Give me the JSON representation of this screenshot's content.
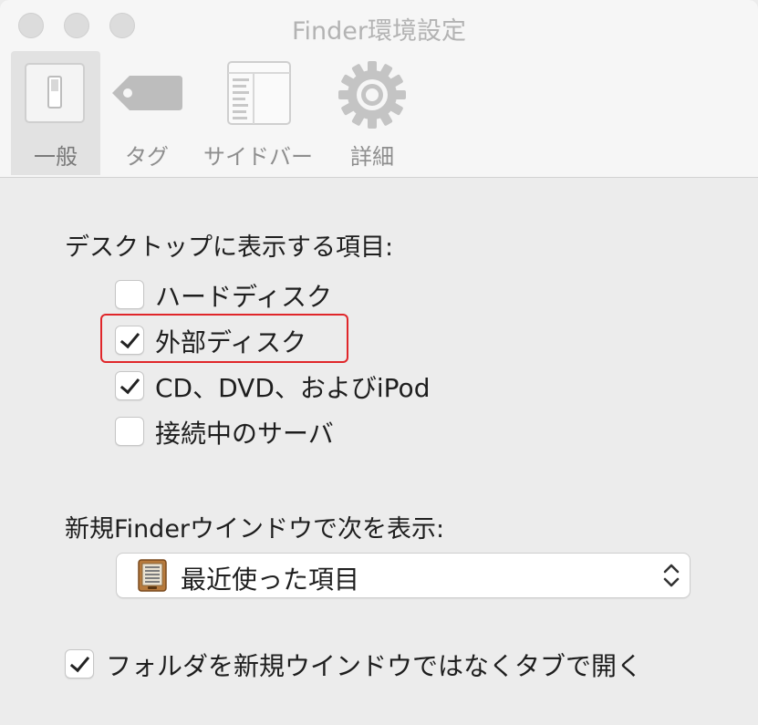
{
  "window": {
    "title": "Finder環境設定"
  },
  "toolbar": {
    "tabs": [
      {
        "label": "一般",
        "icon": "switch-icon",
        "selected": true
      },
      {
        "label": "タグ",
        "icon": "tag-icon",
        "selected": false
      },
      {
        "label": "サイドバー",
        "icon": "sidebar-icon",
        "selected": false
      },
      {
        "label": "詳細",
        "icon": "gear-icon",
        "selected": false
      }
    ]
  },
  "desktop_items": {
    "heading": "デスクトップに表示する項目:",
    "options": [
      {
        "label": "ハードディスク",
        "checked": false
      },
      {
        "label": "外部ディスク",
        "checked": true
      },
      {
        "label": "CD、DVD、およびiPod",
        "checked": true
      },
      {
        "label": "接続中のサーバ",
        "checked": false
      }
    ]
  },
  "new_window": {
    "heading": "新規Finderウインドウで次を表示:",
    "selected_value": "最近使った項目",
    "icon": "recents-cabinet-icon"
  },
  "open_folders_in_tabs": {
    "label": "フォルダを新規ウインドウではなくタブで開く",
    "checked": true
  },
  "colors": {
    "highlight": "#e0262a",
    "title": "#b3b3b3"
  }
}
